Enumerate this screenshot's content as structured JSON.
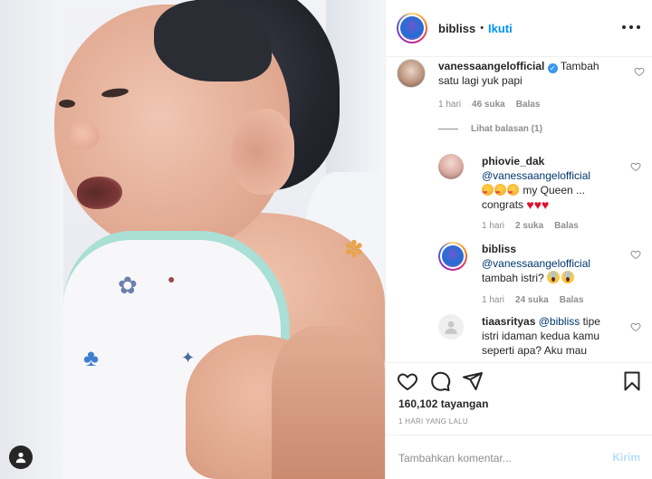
{
  "post": {
    "username": "bibliss",
    "separator": "•",
    "follow_label": "Ikuti",
    "more_icon": "more-horizontal-icon"
  },
  "comments": [
    {
      "username": "vanessaangelofficial",
      "verified": true,
      "text": "Tambah satu lagi yuk papi",
      "time": "1 hari",
      "likes": "46 suka",
      "reply_label": "Balas",
      "view_replies": "Lihat balasan (1)"
    },
    {
      "username": "phiovie_dak",
      "mention": "@vanessaangelofficial",
      "text": "my Queen ... congrats",
      "time": "1 hari",
      "likes": "2 suka",
      "reply_label": "Balas"
    },
    {
      "username": "bibliss",
      "mention": "@vanessaangelofficial",
      "text": "tambah istri?",
      "time": "1 hari",
      "likes": "24 suka",
      "reply_label": "Balas"
    },
    {
      "username": "tiaasrityas",
      "mention": "@bibliss",
      "text_line1": "tipe",
      "text_line2": "istri idaman kedua kamu",
      "text_line3": "seperti apa? Aku mau"
    }
  ],
  "actions": {
    "views": "160,102 tayangan",
    "date": "1 HARI YANG LALU"
  },
  "add_comment": {
    "placeholder": "Tambahkan komentar...",
    "post_label": "Kirim"
  },
  "colors": {
    "accent": "#0095f6",
    "post_disabled": "#b2dffc",
    "secondary_text": "#8e8e8e"
  }
}
